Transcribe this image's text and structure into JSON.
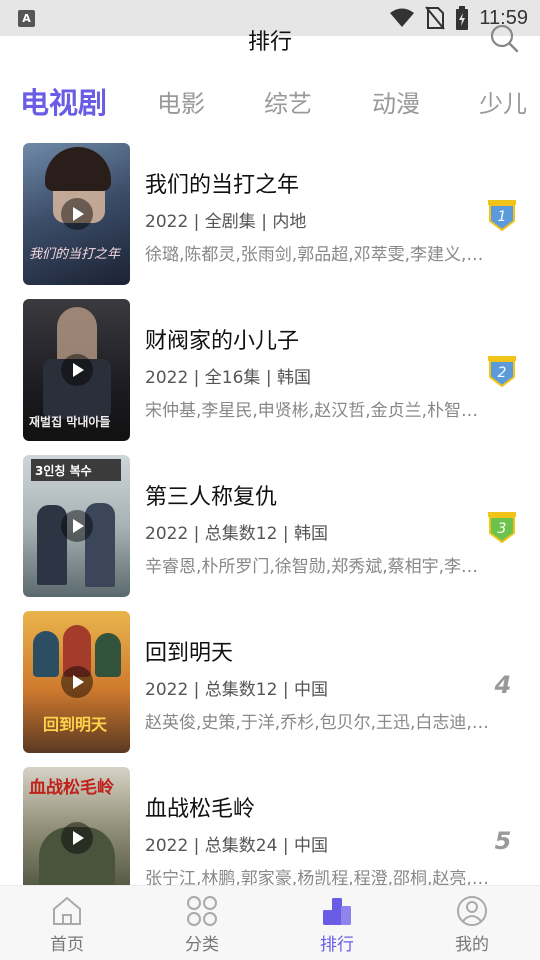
{
  "status_bar": {
    "app_icon": "A",
    "time": "11:59"
  },
  "header": {
    "title": "排行"
  },
  "tabs": [
    {
      "label": "电视剧",
      "active": true
    },
    {
      "label": "电影",
      "active": false
    },
    {
      "label": "综艺",
      "active": false
    },
    {
      "label": "动漫",
      "active": false
    },
    {
      "label": "少儿",
      "active": false
    }
  ],
  "items": [
    {
      "title": "我们的当打之年",
      "meta": "2022 | 全剧集 | 内地",
      "cast": "徐璐,陈都灵,张雨剑,郭品超,邓萃雯,李建义,…",
      "rank": "1",
      "badge_color": "#5b9bdc",
      "poster_text": "我们的当打之年"
    },
    {
      "title": "财阀家的小儿子",
      "meta": "2022 | 全16集 | 韩国",
      "cast": "宋仲基,李星民,申贤彬,赵汉哲,金贞兰,朴智…",
      "rank": "2",
      "badge_color": "#5b9bdc",
      "poster_text": "재벌집 막내아들"
    },
    {
      "title": "第三人称复仇",
      "meta": "2022 | 总集数12 | 韩国",
      "cast": "辛睿恩,朴所罗门,徐智勋,郑秀斌,蔡相宇,李…",
      "rank": "3",
      "badge_color": "#6cc24a",
      "poster_text": "3인칭 복수"
    },
    {
      "title": "回到明天",
      "meta": "2022 | 总集数12 | 中国",
      "cast": "赵英俊,史策,于洋,乔杉,包贝尔,王迅,白志迪,…",
      "rank": "4",
      "badge_color": "",
      "poster_text": "回到明天"
    },
    {
      "title": "血战松毛岭",
      "meta": "2022 | 总集数24 | 中国",
      "cast": "张宁江,林鹏,郭家豪,杨凯程,程澄,邵桐,赵亮,…",
      "rank": "5",
      "badge_color": "",
      "poster_text": "血战松毛岭"
    }
  ],
  "bottom_nav": [
    {
      "label": "首页",
      "icon": "home-icon",
      "active": false
    },
    {
      "label": "分类",
      "icon": "grid-icon",
      "active": false
    },
    {
      "label": "排行",
      "icon": "ranking-icon",
      "active": true
    },
    {
      "label": "我的",
      "icon": "profile-icon",
      "active": false
    }
  ],
  "colors": {
    "accent": "#6b5ce6",
    "muted": "#999999"
  }
}
